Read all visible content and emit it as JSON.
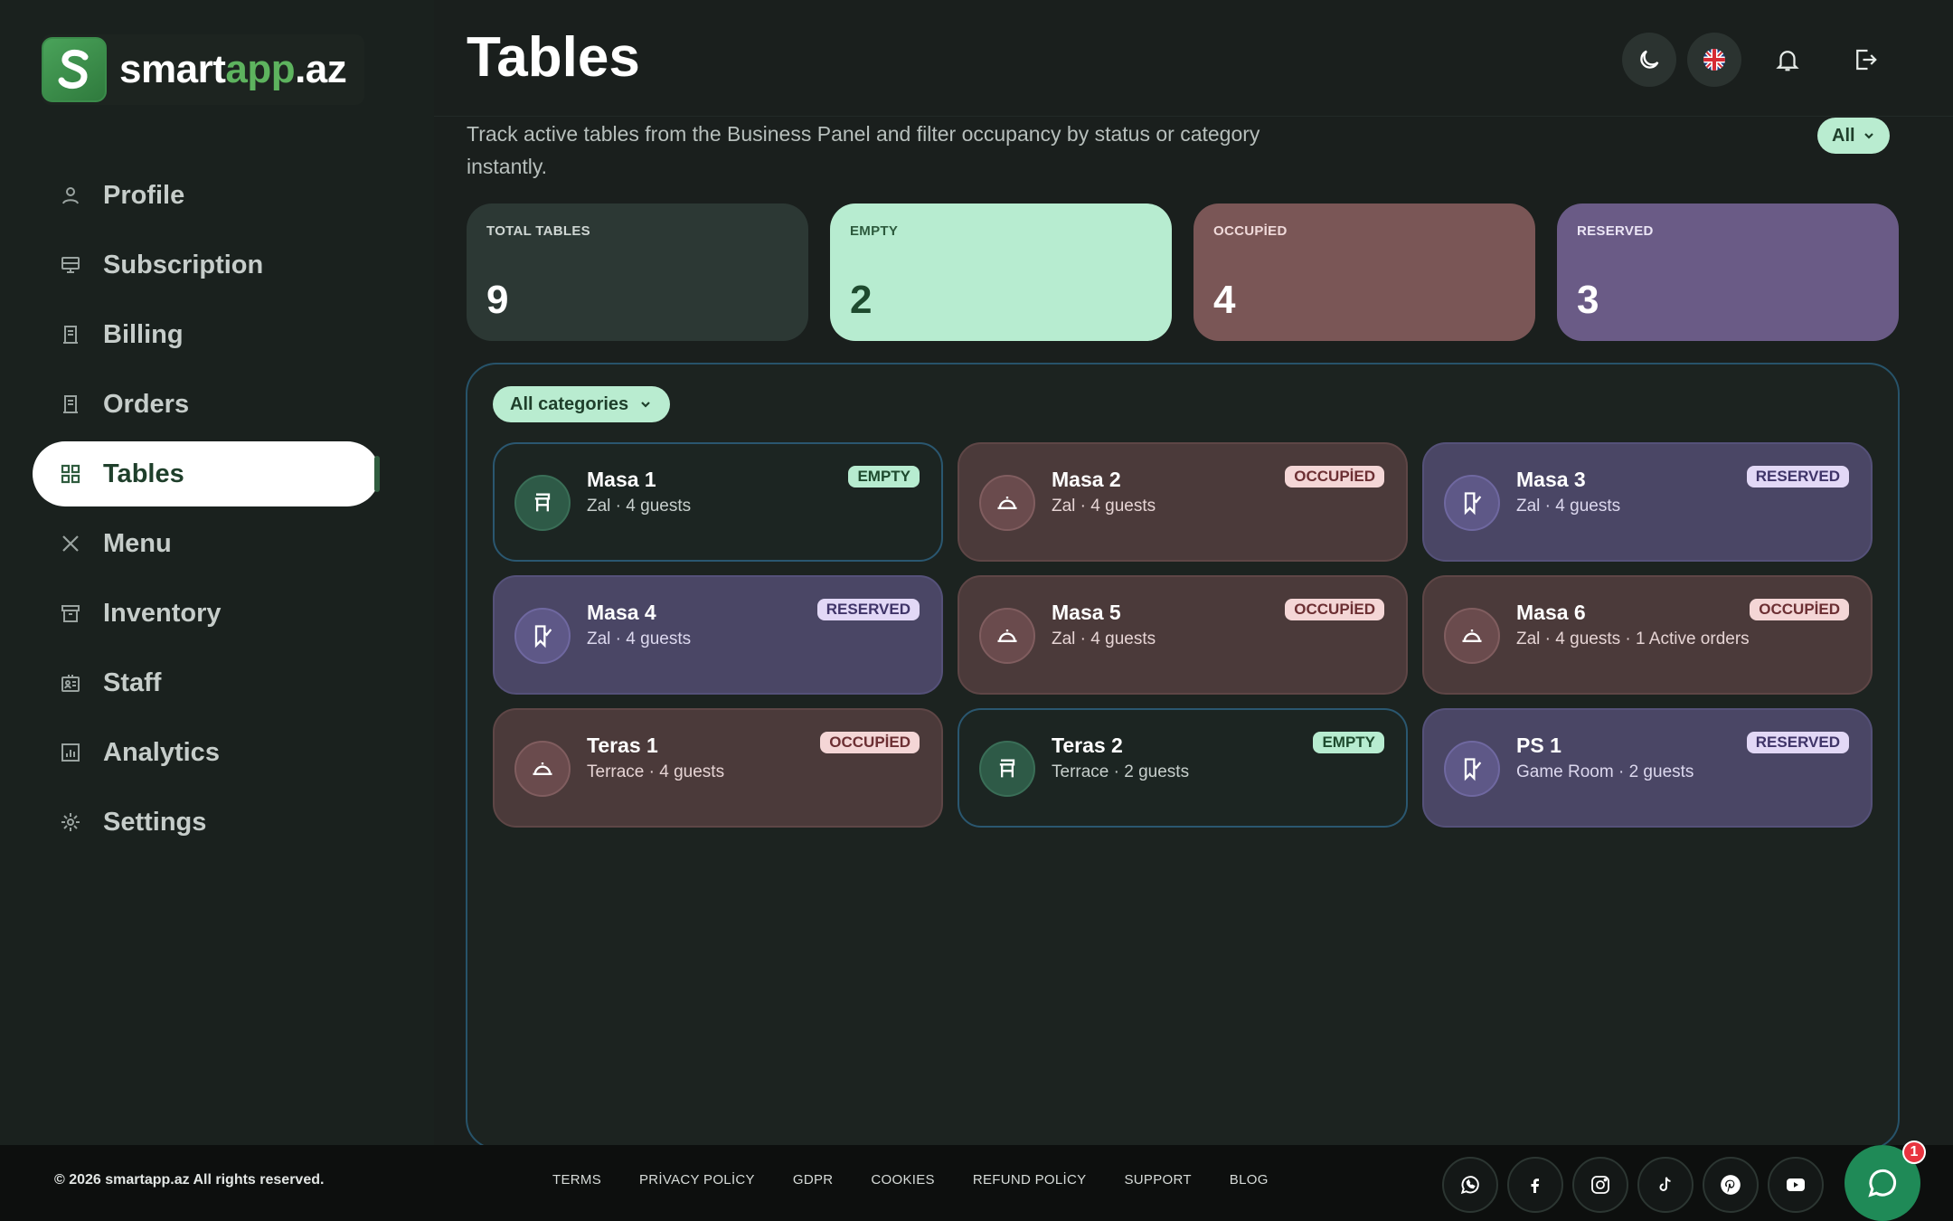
{
  "brand": {
    "name_white": "smart",
    "name_green": "app",
    "name_suffix": ".az",
    "logo_letter": "S"
  },
  "sidebar": {
    "items": [
      {
        "label": "Profile",
        "icon": "user-icon"
      },
      {
        "label": "Subscription",
        "icon": "monitor-icon"
      },
      {
        "label": "Billing",
        "icon": "receipt-icon"
      },
      {
        "label": "Orders",
        "icon": "receipt-icon"
      },
      {
        "label": "Tables",
        "icon": "grid-icon",
        "active": true
      },
      {
        "label": "Menu",
        "icon": "utensils-icon"
      },
      {
        "label": "Inventory",
        "icon": "archive-icon"
      },
      {
        "label": "Staff",
        "icon": "id-card-icon"
      },
      {
        "label": "Analytics",
        "icon": "chart-icon"
      },
      {
        "label": "Settings",
        "icon": "gear-icon"
      }
    ]
  },
  "header": {
    "title": "Tables",
    "subtitle": "Track active tables from the Business Panel and filter occupancy by status or category instantly.",
    "status_filter": "All"
  },
  "stats": {
    "total": {
      "label": "TOTAL TABLES",
      "value": "9"
    },
    "empty": {
      "label": "EMPTY",
      "value": "2"
    },
    "occupied": {
      "label": "OCCUPİED",
      "value": "4"
    },
    "reserved": {
      "label": "RESERVED",
      "value": "3"
    }
  },
  "category_filter": "All categories",
  "tables": [
    {
      "name": "Masa 1",
      "meta": "Zal · 4 guests",
      "status": "EMPTY"
    },
    {
      "name": "Masa 2",
      "meta": "Zal · 4 guests",
      "status": "OCCUPİED"
    },
    {
      "name": "Masa 3",
      "meta": "Zal · 4 guests",
      "status": "RESERVED"
    },
    {
      "name": "Masa 4",
      "meta": "Zal · 4 guests",
      "status": "RESERVED"
    },
    {
      "name": "Masa 5",
      "meta": "Zal · 4 guests",
      "status": "OCCUPİED"
    },
    {
      "name": "Masa 6",
      "meta": "Zal · 4 guests · 1 Active orders",
      "status": "OCCUPİED"
    },
    {
      "name": "Teras 1",
      "meta": "Terrace · 4 guests",
      "status": "OCCUPİED"
    },
    {
      "name": "Teras 2",
      "meta": "Terrace · 2 guests",
      "status": "EMPTY"
    },
    {
      "name": "PS 1",
      "meta": "Game Room · 2 guests",
      "status": "RESERVED"
    }
  ],
  "footer": {
    "copyright": "© 2026 smartapp.az All rights reserved.",
    "links": [
      "TERMS",
      "PRİVACY POLİCY",
      "GDPR",
      "COOKIES",
      "REFUND POLİCY",
      "SUPPORT",
      "BLOG"
    ],
    "social": [
      "whatsapp-icon",
      "facebook-icon",
      "instagram-icon",
      "tiktok-icon",
      "pinterest-icon",
      "youtube-icon"
    ]
  },
  "chat": {
    "badge_count": "1"
  },
  "colors": {
    "accent": "#b9ecd0",
    "brand_green": "#5db35e",
    "occupied": "#7a5656",
    "reserved": "#6a5b86"
  }
}
